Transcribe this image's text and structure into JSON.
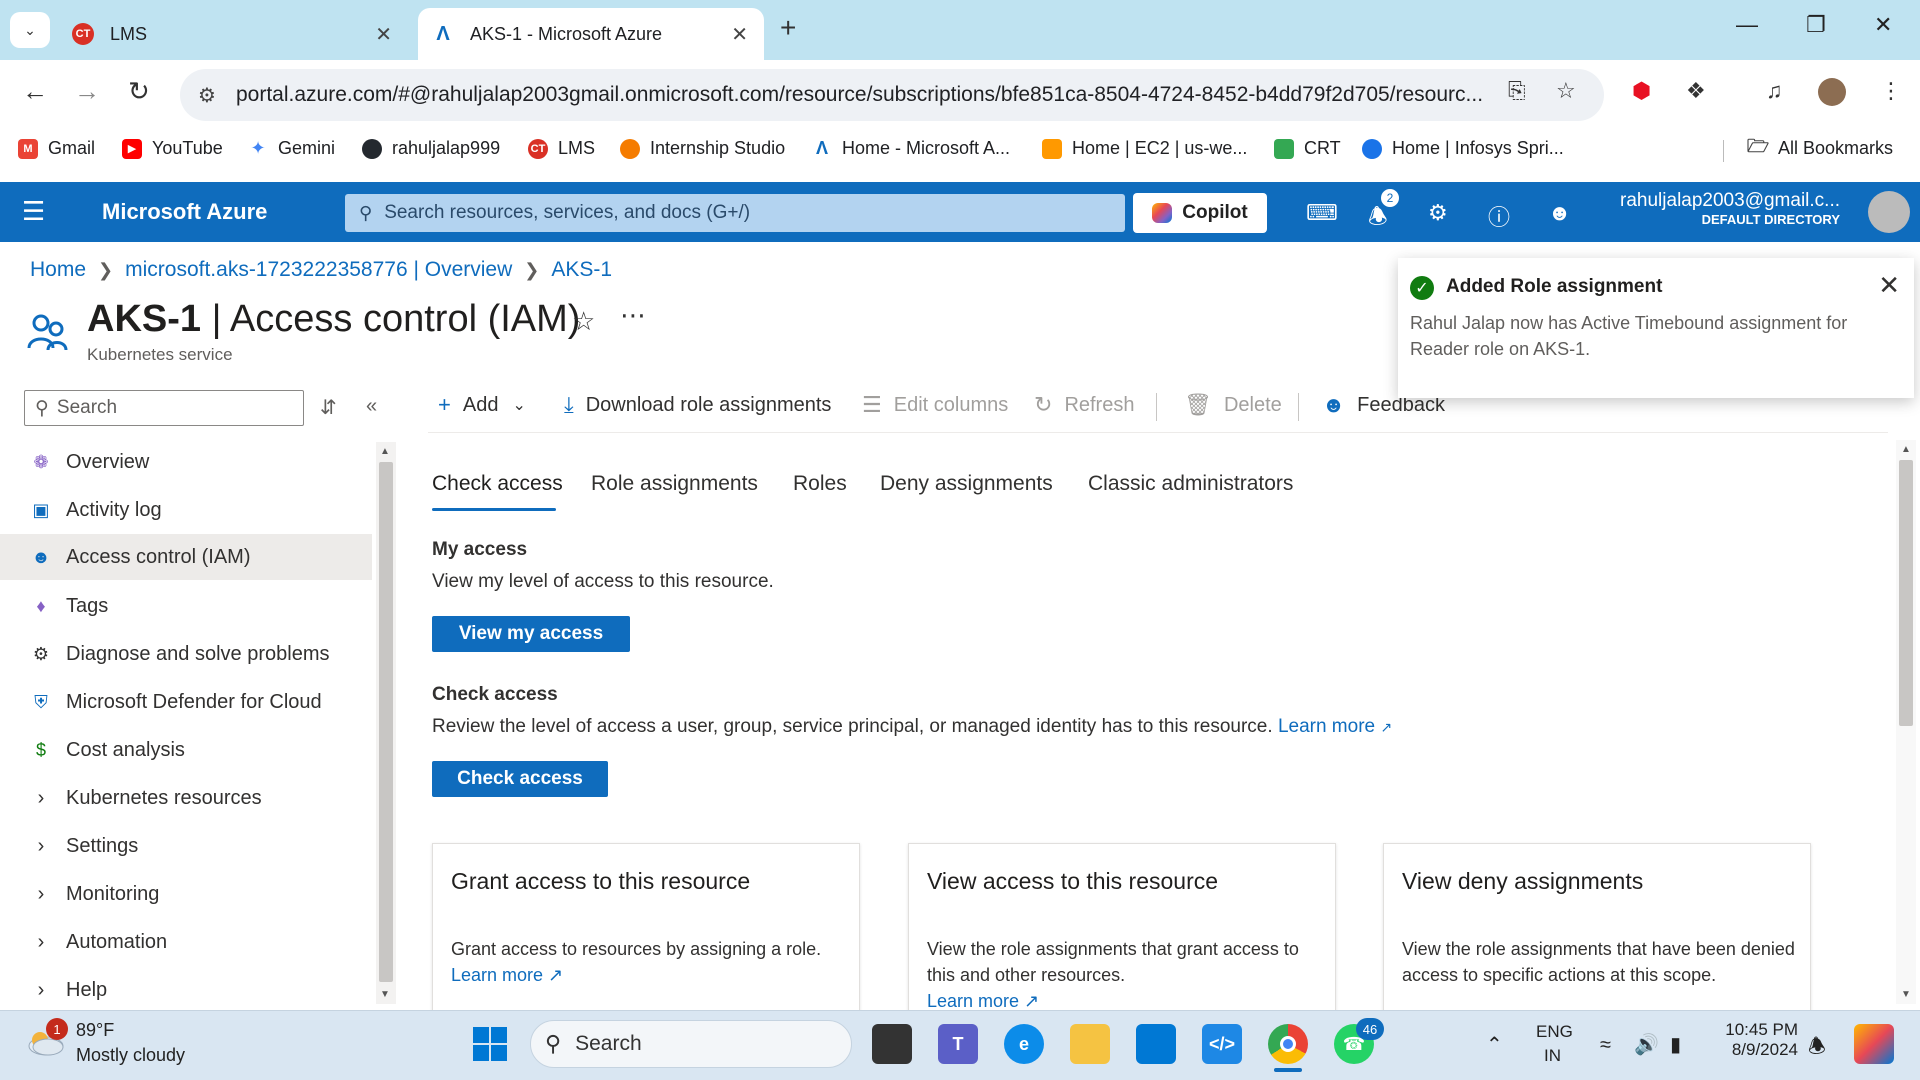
{
  "browser": {
    "tabs": [
      {
        "label": "LMS",
        "active": false,
        "icon": "lms-favicon"
      },
      {
        "label": "AKS-1 - Microsoft Azure",
        "active": true,
        "icon": "azure-favicon"
      }
    ],
    "url": "portal.azure.com/#@rahuljalap2003gmail.onmicrosoft.com/resource/subscriptions/bfe851ca-8504-4724-8452-b4dd79f2d705/resourc...",
    "bookmarks": [
      {
        "label": "Gmail",
        "color": "#ea4335"
      },
      {
        "label": "YouTube",
        "color": "#ff0000"
      },
      {
        "label": "Gemini",
        "color": "#4285f4"
      },
      {
        "label": "rahuljalap999",
        "color": "#24292f"
      },
      {
        "label": "LMS",
        "color": "#d93025"
      },
      {
        "label": "Internship Studio",
        "color": "#f57c00"
      },
      {
        "label": "Home - Microsoft A...",
        "color": "#0f6cbd"
      },
      {
        "label": "Home | EC2 | us-we...",
        "color": "#ff9900"
      },
      {
        "label": "CRT",
        "color": "#34a853"
      },
      {
        "label": "Home | Infosys Spri...",
        "color": "#1a73e8"
      }
    ],
    "all_bookmarks": "All Bookmarks"
  },
  "azure": {
    "brand": "Microsoft Azure",
    "search_placeholder": "Search resources, services, and docs (G+/)",
    "copilot": "Copilot",
    "notification_count": "2",
    "user_email": "rahuljalap2003@gmail.c...",
    "directory": "DEFAULT DIRECTORY",
    "brand_color": "#0f6cbd"
  },
  "breadcrumb": [
    "Home",
    "microsoft.aks-1723222358776 | Overview",
    "AKS-1"
  ],
  "page": {
    "title_bold": "AKS-1",
    "title_rest": " | Access control (IAM)",
    "subtitle": "Kubernetes service"
  },
  "leftnav": {
    "search_placeholder": "Search",
    "items": [
      {
        "label": "Overview",
        "icon": "overview-icon"
      },
      {
        "label": "Activity log",
        "icon": "activity-log-icon"
      },
      {
        "label": "Access control (IAM)",
        "icon": "iam-icon",
        "selected": true
      },
      {
        "label": "Tags",
        "icon": "tag-icon"
      },
      {
        "label": "Diagnose and solve problems",
        "icon": "wrench-icon"
      },
      {
        "label": "Microsoft Defender for Cloud",
        "icon": "shield-icon"
      },
      {
        "label": "Cost analysis",
        "icon": "cost-icon"
      },
      {
        "label": "Kubernetes resources",
        "icon": "chevron-right-icon"
      },
      {
        "label": "Settings",
        "icon": "chevron-right-icon"
      },
      {
        "label": "Monitoring",
        "icon": "chevron-right-icon"
      },
      {
        "label": "Automation",
        "icon": "chevron-right-icon"
      },
      {
        "label": "Help",
        "icon": "chevron-right-icon"
      }
    ]
  },
  "commandbar": {
    "add": "Add",
    "download": "Download role assignments",
    "edit_columns": "Edit columns",
    "refresh": "Refresh",
    "delete": "Delete",
    "feedback": "Feedback"
  },
  "tabs": [
    "Check access",
    "Role assignments",
    "Roles",
    "Deny assignments",
    "Classic administrators"
  ],
  "content": {
    "my_access_title": "My access",
    "my_access_desc": "View my level of access to this resource.",
    "view_my_access_btn": "View my access",
    "check_access_title": "Check access",
    "check_access_desc": "Review the level of access a user, group, service principal, or managed identity has to this resource.",
    "learn_more": "Learn more",
    "check_access_btn": "Check access",
    "cards": [
      {
        "title": "Grant access to this resource",
        "desc": "Grant access to resources by assigning a role.",
        "link": "Learn more"
      },
      {
        "title": "View access to this resource",
        "desc": "View the role assignments that grant access to this and other resources.",
        "link": "Learn more"
      },
      {
        "title": "View deny assignments",
        "desc": "View the role assignments that have been denied access to specific actions at this scope.",
        "link": ""
      }
    ]
  },
  "toast": {
    "title": "Added Role assignment",
    "message": "Rahul Jalap now has Active Timebound assignment for Reader role on AKS-1."
  },
  "taskbar": {
    "weather_badge": "1",
    "temperature": "89°F",
    "weather": "Mostly cloudy",
    "search": "Search",
    "whatsapp_badge": "46",
    "lang_top": "ENG",
    "lang_bottom": "IN",
    "time": "10:45 PM",
    "date": "8/9/2024"
  }
}
